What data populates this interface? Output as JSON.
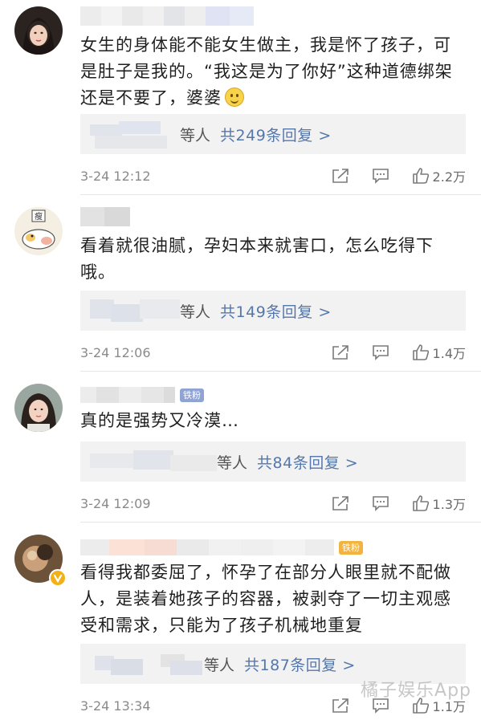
{
  "comments": [
    {
      "text": "女生的身体能不能女生做主，我是怀了孩子，可是肚子是我的。“我这是为了你好”这种道德绑架还是不要了，婆婆",
      "emoji": "smile-emoji",
      "reply_suffix": "等人",
      "reply_link": "共249条回复 >",
      "time": "3-24 12:12",
      "likes": "2.2万"
    },
    {
      "text": "看着就很油腻，孕妇本来就害口，怎么吃得下哦。",
      "reply_suffix": "等人",
      "reply_link": "共149条回复 >",
      "time": "3-24 12:06",
      "likes": "1.4万"
    },
    {
      "badge": "铁粉",
      "text": "真的是强势又冷漠…",
      "reply_suffix": "等人",
      "reply_link": "共84条回复 >",
      "time": "3-24 12:09",
      "likes": "1.3万"
    },
    {
      "badge": "铁粉",
      "text": "看得我都委屈了，怀孕了在部分人眼里就不配做人，是装着她孩子的容器，被剥夺了一切主观感受和需求，只能为了孩子机械地重复",
      "reply_suffix": "等人",
      "reply_link": "共187条回复 >",
      "time": "3-24 13:34",
      "likes": "1.1万"
    }
  ],
  "watermark": "橘子娱乐App",
  "colors": {
    "link": "#5577aa",
    "reply_bg": "#f2f2f2",
    "meta": "#8a8a8a"
  }
}
